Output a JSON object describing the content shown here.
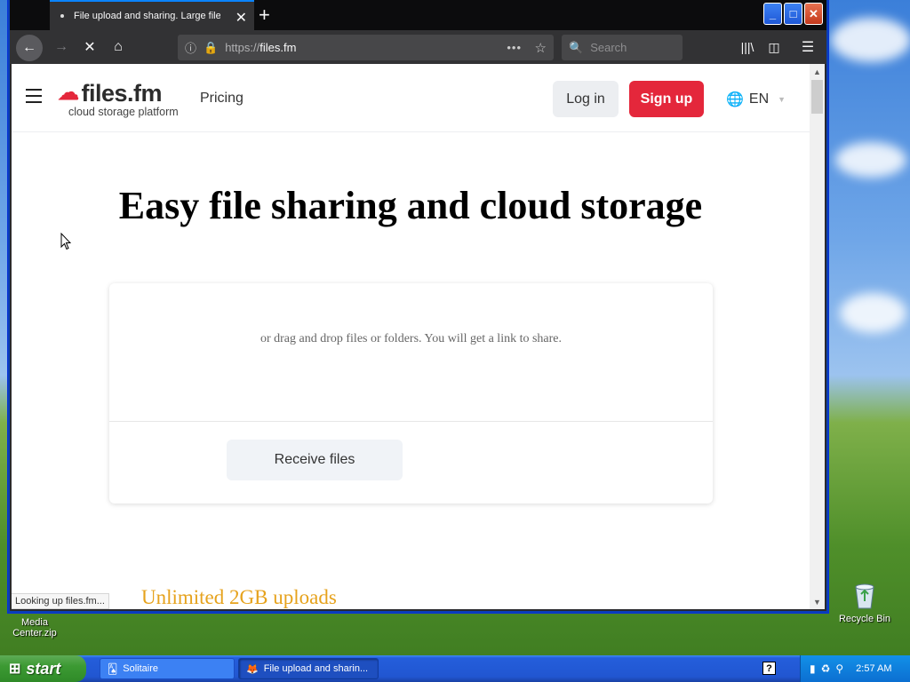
{
  "browser": {
    "tab_title": "File upload and sharing. Large file",
    "url_scheme": "https://",
    "url_host": "files.fm",
    "search_placeholder": "Search",
    "status_text": "Looking up files.fm..."
  },
  "site": {
    "logo_text": "files.fm",
    "logo_tagline": "cloud storage platform",
    "nav_pricing": "Pricing",
    "login_label": "Log in",
    "signup_label": "Sign up",
    "language": "EN",
    "hero_title": "Easy file sharing and cloud storage",
    "upload_hint": "or drag and drop files or folders. You will get a link to share.",
    "receive_label": "Receive files",
    "promo_partial": "Unlimited 2GB uploads"
  },
  "desktop": {
    "icon_media_center": "Media Center.zip",
    "icon_recycle_bin": "Recycle Bin"
  },
  "taskbar": {
    "start_label": "start",
    "tasks": [
      {
        "label": "Solitaire"
      },
      {
        "label": "File upload and sharin..."
      }
    ],
    "clock": "2:57 AM"
  },
  "colors": {
    "accent_red": "#e4273b",
    "promo_gold": "#e6a21c",
    "firefox_blue": "#0a84ff"
  }
}
